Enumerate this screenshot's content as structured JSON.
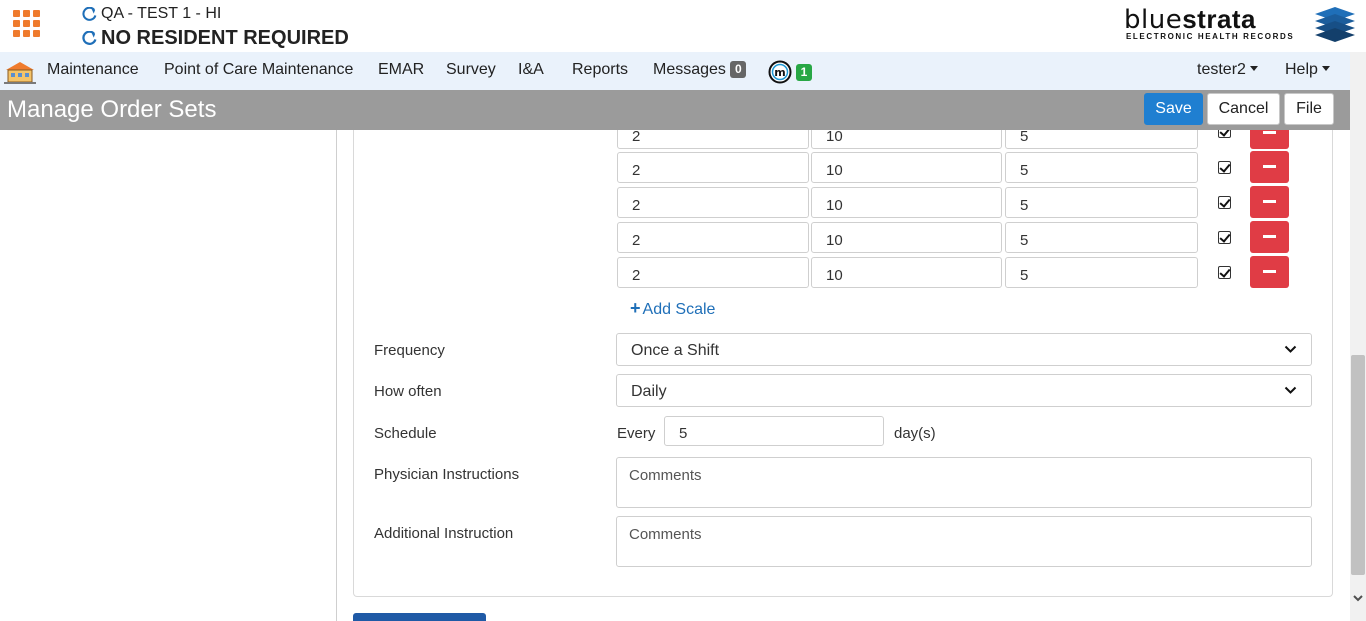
{
  "header": {
    "facility_line": "QA - TEST 1 - HI",
    "resident_line": "NO RESIDENT REQUIRED",
    "logo": {
      "brand_light": "blue",
      "brand_bold": "strata",
      "tagline": "ELECTRONIC HEALTH RECORDS"
    }
  },
  "nav": {
    "items": [
      "Maintenance",
      "Point of Care Maintenance",
      "EMAR",
      "Survey",
      "I&A",
      "Reports",
      "Messages"
    ],
    "messages_count": "0",
    "m_count": "1",
    "user": "tester2",
    "help": "Help"
  },
  "titlebar": {
    "title": "Manage Order Sets",
    "save": "Save",
    "cancel": "Cancel",
    "file": "File"
  },
  "scales": [
    {
      "a": "2",
      "b": "10",
      "c": "5",
      "checked": true
    },
    {
      "a": "2",
      "b": "10",
      "c": "5",
      "checked": true
    },
    {
      "a": "2",
      "b": "10",
      "c": "5",
      "checked": true
    },
    {
      "a": "2",
      "b": "10",
      "c": "5",
      "checked": true
    },
    {
      "a": "2",
      "b": "10",
      "c": "5",
      "checked": true
    }
  ],
  "add_scale": "Add Scale",
  "form": {
    "frequency_label": "Frequency",
    "frequency_value": "Once a Shift",
    "how_often_label": "How often",
    "how_often_value": "Daily",
    "schedule_label": "Schedule",
    "schedule_every": "Every",
    "schedule_value": "5",
    "schedule_unit": "day(s)",
    "physician_label": "Physician Instructions",
    "physician_placeholder": "Comments",
    "additional_label": "Additional Instruction",
    "additional_placeholder": "Comments"
  },
  "colors": {
    "accent": "#1f7fd1",
    "danger": "#e03c45",
    "nav_bg": "#eaf2fb",
    "title_bg": "#9b9b9b",
    "grid_icon": "#ef7b2d"
  },
  "icons": [
    "app-grid-icon",
    "refresh-icon",
    "bluestrata-logo",
    "home-icon",
    "m-icon",
    "chevron-down-icon",
    "remove-icon"
  ]
}
